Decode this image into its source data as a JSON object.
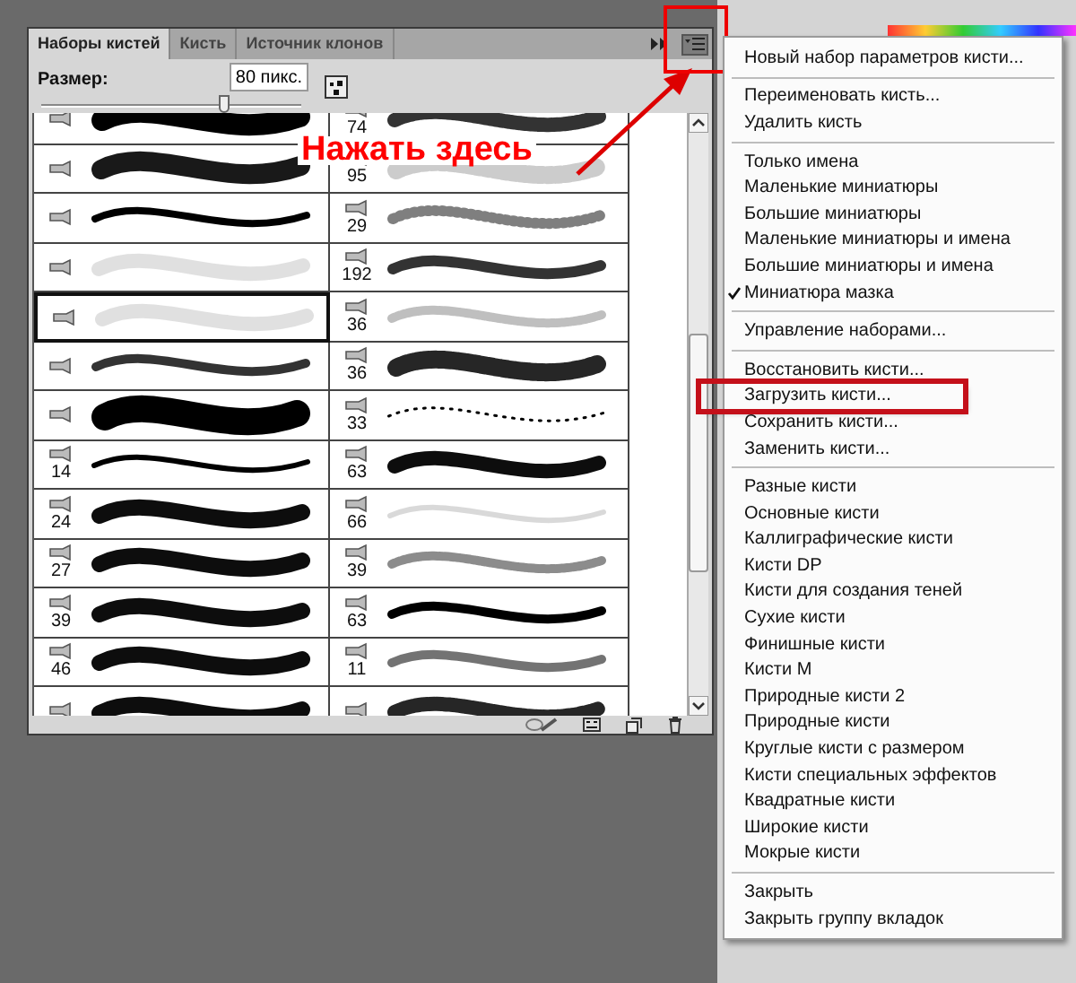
{
  "panel": {
    "tabs": [
      {
        "label": "Наборы кистей",
        "selected": true
      },
      {
        "label": "Кисть",
        "selected": false
      },
      {
        "label": "Источник клонов",
        "selected": false
      }
    ],
    "size_label": "Размер:",
    "size_value": "80 пикс.",
    "size_slider": {
      "level": 0.7
    },
    "brushes": [
      {
        "left": {
          "selected": false
        },
        "right": {
          "size": "74"
        }
      },
      {
        "left": {
          "selected": false
        },
        "right": {
          "size": "95"
        }
      },
      {
        "left": {
          "selected": false
        },
        "right": {
          "size": "29"
        }
      },
      {
        "left": {
          "selected": false
        },
        "right": {
          "size": "192"
        }
      },
      {
        "left": {
          "selected": true
        },
        "right": {
          "size": "36"
        }
      },
      {
        "left": {
          "selected": false
        },
        "right": {
          "size": "36"
        }
      },
      {
        "left": {
          "selected": false
        },
        "right": {
          "size": "33"
        }
      },
      {
        "left": {
          "selected": false,
          "size": "14"
        },
        "right": {
          "size": "63"
        }
      },
      {
        "left": {
          "selected": false,
          "size": "24"
        },
        "right": {
          "size": "66"
        }
      },
      {
        "left": {
          "selected": false,
          "size": "27"
        },
        "right": {
          "size": "39"
        }
      },
      {
        "left": {
          "selected": false,
          "size": "39"
        },
        "right": {
          "size": "63"
        }
      },
      {
        "left": {
          "selected": false,
          "size": "46"
        },
        "right": {
          "size": "11"
        }
      },
      {
        "left": {
          "selected": false
        }
      }
    ]
  },
  "annotation": {
    "text": "Нажать здесь"
  },
  "menu": {
    "groups": [
      [
        {
          "label": "Новый набор параметров кисти...",
          "checked": false
        }
      ],
      [
        {
          "label": "Переименовать кисть...",
          "checked": false
        },
        {
          "label": "Удалить кисть",
          "checked": false
        }
      ],
      [
        {
          "label": "Только имена",
          "checked": false
        },
        {
          "label": "Маленькие миниатюры",
          "checked": false
        },
        {
          "label": "Большие миниатюры",
          "checked": false
        },
        {
          "label": "Маленькие миниатюры и имена",
          "checked": false
        },
        {
          "label": "Большие миниатюры и имена",
          "checked": false
        },
        {
          "label": "Миниатюра мазка",
          "checked": true
        }
      ],
      [
        {
          "label": "Управление наборами...",
          "checked": false
        }
      ],
      [
        {
          "label": "Восстановить кисти...",
          "checked": false
        },
        {
          "label": "Загрузить кисти...",
          "checked": false,
          "highlighted": true
        },
        {
          "label": "Сохранить кисти...",
          "checked": false
        },
        {
          "label": "Заменить кисти...",
          "checked": false
        }
      ],
      [
        {
          "label": "Разные кисти",
          "checked": false
        },
        {
          "label": "Основные кисти",
          "checked": false
        },
        {
          "label": "Каллиграфические кисти",
          "checked": false
        },
        {
          "label": "Кисти DP",
          "checked": false
        },
        {
          "label": "Кисти для создания теней",
          "checked": false
        },
        {
          "label": "Сухие кисти",
          "checked": false
        },
        {
          "label": "Финишные кисти",
          "checked": false
        },
        {
          "label": "Кисти M",
          "checked": false
        },
        {
          "label": "Природные кисти 2",
          "checked": false
        },
        {
          "label": "Природные кисти",
          "checked": false
        },
        {
          "label": "Круглые кисти с размером",
          "checked": false
        },
        {
          "label": "Кисти специальных эффектов",
          "checked": false
        },
        {
          "label": "Квадратные кисти",
          "checked": false
        },
        {
          "label": "Широкие кисти",
          "checked": false
        },
        {
          "label": "Мокрые кисти",
          "checked": false
        }
      ],
      [
        {
          "label": "Закрыть",
          "checked": false
        },
        {
          "label": "Закрыть группу вкладок",
          "checked": false
        }
      ]
    ]
  }
}
